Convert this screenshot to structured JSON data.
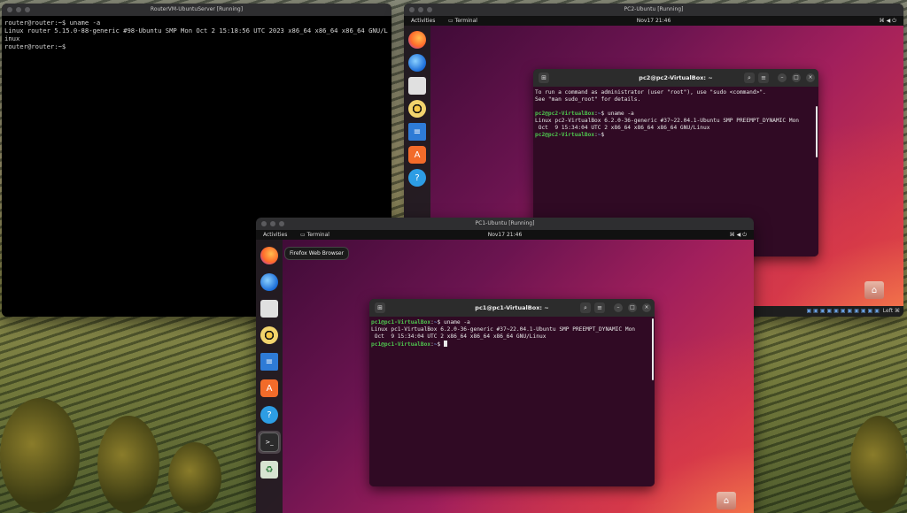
{
  "colors": {
    "ubuntu_purple": "#300a24",
    "prompt_green": "#4ec44e",
    "path_blue": "#6f9bdc"
  },
  "router_vm": {
    "title": "RouterVM-UbuntuServer [Running]",
    "console_lines": [
      "router@router:~$ uname -a",
      "Linux router 5.15.0-88-generic #98-Ubuntu SMP Mon Oct 2 15:18:56 UTC 2023 x86_64 x86_64 x86_64 GNU/L",
      "inux",
      "router@router:~$ "
    ]
  },
  "pc2_vm": {
    "title": "PC2-Ubuntu [Running]",
    "topbar": {
      "activities": "Activities",
      "app": "Terminal",
      "clock": "Nov17  21:46"
    },
    "terminal": {
      "title": "pc2@pc2-VirtualBox: ~",
      "line1": "To run a command as administrator (user \"root\"), use \"sudo <command>\".",
      "line2": "See \"man sudo_root\" for details.",
      "prompt_user": "pc2@pc2-VirtualBox",
      "prompt_path": "~",
      "command": "uname -a",
      "output1": "Linux pc2-VirtualBox 6.2.0-36-generic #37~22.04.1-Ubuntu SMP PREEMPT_DYNAMIC Mon",
      "output2": " Oct  9 15:34:04 UTC 2 x86_64 x86_64 x86_64 GNU/Linux"
    },
    "statusbar_hostkey": "Left ⌘"
  },
  "pc1_vm": {
    "title": "PC1-Ubuntu [Running]",
    "topbar": {
      "activities": "Activities",
      "app": "Terminal",
      "clock": "Nov17  21:46"
    },
    "tooltip": "Firefox Web Browser",
    "terminal": {
      "title": "pc1@pc1-VirtualBox: ~",
      "prompt_user": "pc1@pc1-VirtualBox",
      "prompt_path": "~",
      "command": "uname -a",
      "output1": "Linux pc1-VirtualBox 6.2.0-36-generic #37~22.04.1-Ubuntu SMP PREEMPT_DYNAMIC Mon",
      "output2": " Oct  9 15:34:04 UTC 2 x86_64 x86_64 x86_64 GNU/Linux"
    }
  },
  "dock_icons": [
    "firefox-icon",
    "thunderbird-icon",
    "files-icon",
    "rhythmbox-icon",
    "writer-icon",
    "app-center-icon",
    "help-icon",
    "terminal-icon",
    "trash-icon"
  ]
}
